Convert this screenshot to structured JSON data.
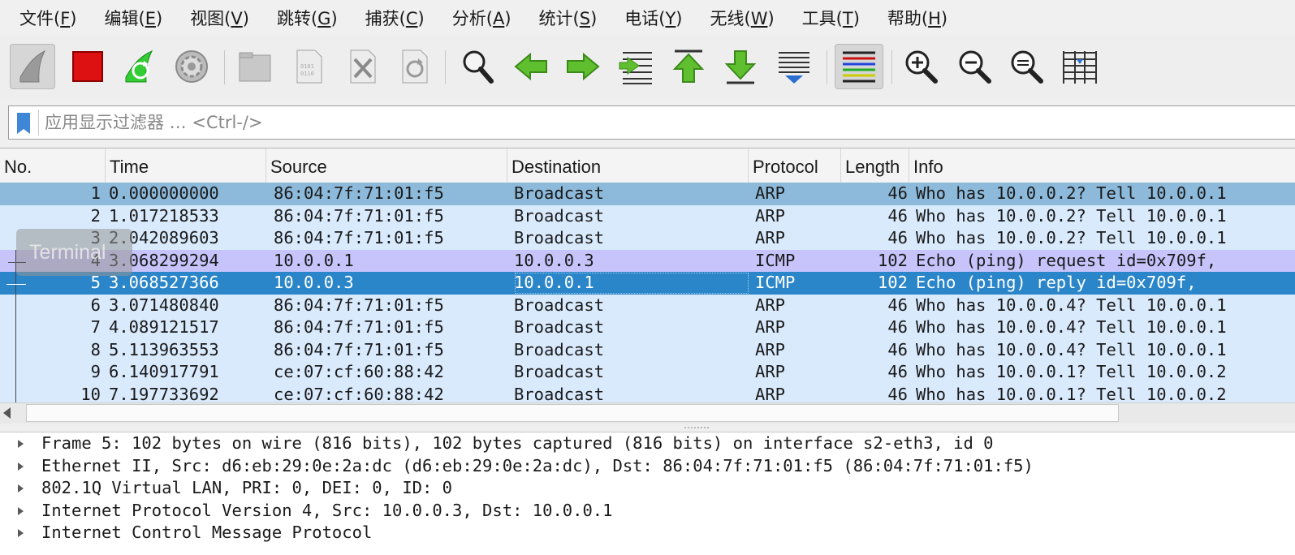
{
  "menu": [
    {
      "label": "文件(",
      "key": "F",
      "end": ")"
    },
    {
      "label": "编辑(",
      "key": "E",
      "end": ")"
    },
    {
      "label": "视图(",
      "key": "V",
      "end": ")"
    },
    {
      "label": "跳转(",
      "key": "G",
      "end": ")"
    },
    {
      "label": "捕获(",
      "key": "C",
      "end": ")"
    },
    {
      "label": "分析(",
      "key": "A",
      "end": ")"
    },
    {
      "label": "统计(",
      "key": "S",
      "end": ")"
    },
    {
      "label": "电话(",
      "key": "Y",
      "end": ")"
    },
    {
      "label": "无线(",
      "key": "W",
      "end": ")"
    },
    {
      "label": "工具(",
      "key": "T",
      "end": ")"
    },
    {
      "label": "帮助(",
      "key": "H",
      "end": ")"
    }
  ],
  "toolbar": {
    "icons": [
      "start-capture-icon",
      "stop-capture-icon",
      "restart-capture-icon",
      "capture-options-icon",
      "open-file-icon",
      "save-file-icon",
      "close-file-icon",
      "reload-file-icon",
      "find-packet-icon",
      "go-back-icon",
      "go-forward-icon",
      "go-to-packet-icon",
      "go-first-icon",
      "go-last-icon",
      "auto-scroll-icon",
      "colorize-icon",
      "zoom-in-icon",
      "zoom-out-icon",
      "normal-size-icon",
      "resize-columns-icon"
    ]
  },
  "filter": {
    "placeholder": "应用显示过滤器 … <Ctrl-/>",
    "bookmark_color": "#3f86d6"
  },
  "packet_list": {
    "columns": [
      "No.",
      "Time",
      "Source",
      "Destination",
      "Protocol",
      "Length",
      "Info"
    ],
    "rows": [
      {
        "no": "1",
        "time": "0.000000000",
        "source": "86:04:7f:71:01:f5",
        "destination": "Broadcast",
        "protocol": "ARP",
        "length": "46",
        "info": "Who has 10.0.0.2? Tell 10.0.0.1"
      },
      {
        "no": "2",
        "time": "1.017218533",
        "source": "86:04:7f:71:01:f5",
        "destination": "Broadcast",
        "protocol": "ARP",
        "length": "46",
        "info": "Who has 10.0.0.2? Tell 10.0.0.1"
      },
      {
        "no": "3",
        "time": "2.042089603",
        "source": "86:04:7f:71:01:f5",
        "destination": "Broadcast",
        "protocol": "ARP",
        "length": "46",
        "info": "Who has 10.0.0.2? Tell 10.0.0.1"
      },
      {
        "no": "4",
        "time": "3.068299294",
        "source": "10.0.0.1",
        "destination": "10.0.0.3",
        "protocol": "ICMP",
        "length": "102",
        "info": "Echo (ping) request  id=0x709f,"
      },
      {
        "no": "5",
        "time": "3.068527366",
        "source": "10.0.0.3",
        "destination": "10.0.0.1",
        "protocol": "ICMP",
        "length": "102",
        "info": "Echo (ping) reply    id=0x709f,"
      },
      {
        "no": "6",
        "time": "3.071480840",
        "source": "86:04:7f:71:01:f5",
        "destination": "Broadcast",
        "protocol": "ARP",
        "length": "46",
        "info": "Who has 10.0.0.4? Tell 10.0.0.1"
      },
      {
        "no": "7",
        "time": "4.089121517",
        "source": "86:04:7f:71:01:f5",
        "destination": "Broadcast",
        "protocol": "ARP",
        "length": "46",
        "info": "Who has 10.0.0.4? Tell 10.0.0.1"
      },
      {
        "no": "8",
        "time": "5.113963553",
        "source": "86:04:7f:71:01:f5",
        "destination": "Broadcast",
        "protocol": "ARP",
        "length": "46",
        "info": "Who has 10.0.0.4? Tell 10.0.0.1"
      },
      {
        "no": "9",
        "time": "6.140917791",
        "source": "ce:07:cf:60:88:42",
        "destination": "Broadcast",
        "protocol": "ARP",
        "length": "46",
        "info": "Who has 10.0.0.1? Tell 10.0.0.2"
      },
      {
        "no": "10",
        "time": "7.197733692",
        "source": "ce:07:cf:60:88:42",
        "destination": "Broadcast",
        "protocol": "ARP",
        "length": "46",
        "info": "Who has 10.0.0.1? Tell 10.0.0.2"
      }
    ],
    "selected_no": "5",
    "colors": {
      "arp": "#d9eafd",
      "arp_first": "#8dbadb",
      "icmp": "#c7c4fb",
      "selected": "#2b86c9"
    }
  },
  "terminal_overlay": {
    "label": "Terminal"
  },
  "details": [
    "Frame 5: 102 bytes on wire (816 bits), 102 bytes captured (816 bits) on interface s2-eth3, id 0",
    "Ethernet II, Src: d6:eb:29:0e:2a:dc (d6:eb:29:0e:2a:dc), Dst: 86:04:7f:71:01:f5 (86:04:7f:71:01:f5)",
    "802.1Q Virtual LAN, PRI: 0, DEI: 0, ID: 0",
    "Internet Protocol Version 4, Src: 10.0.0.3, Dst: 10.0.0.1",
    "Internet Control Message Protocol"
  ]
}
